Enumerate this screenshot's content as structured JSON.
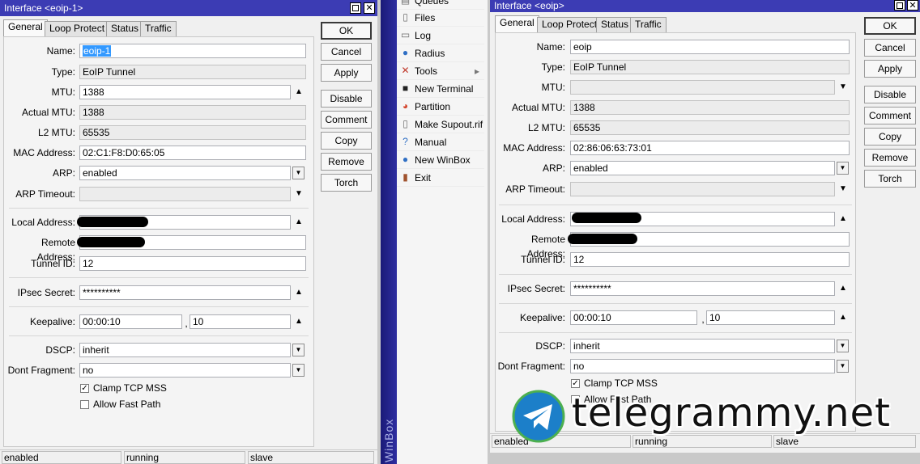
{
  "left_window": {
    "title": "Interface <eoip-1>",
    "tabs": [
      "General",
      "Loop Protect",
      "Status",
      "Traffic"
    ],
    "fields": {
      "name_label": "Name:",
      "name": "eoip-1",
      "type_label": "Type:",
      "type": "EoIP Tunnel",
      "mtu_label": "MTU:",
      "mtu": "1388",
      "actual_mtu_label": "Actual MTU:",
      "actual_mtu": "1388",
      "l2mtu_label": "L2 MTU:",
      "l2mtu": "65535",
      "mac_label": "MAC Address:",
      "mac": "02:C1:F8:D0:65:05",
      "arp_label": "ARP:",
      "arp": "enabled",
      "arp_timeout_label": "ARP Timeout:",
      "arp_timeout": "",
      "local_address_label": "Local Address:",
      "remote_address_label": "Remote Address:",
      "tunnel_id_label": "Tunnel ID:",
      "tunnel_id": "12",
      "ipsec_label": "IPsec Secret:",
      "ipsec": "**********",
      "keepalive_label": "Keepalive:",
      "keepalive": "00:00:10",
      "keepalive_retries": "10",
      "comma": ",",
      "dscp_label": "DSCP:",
      "dscp": "inherit",
      "dont_fragment_label": "Dont Fragment:",
      "dont_fragment": "no",
      "clamp_label": "Clamp TCP MSS",
      "fastpath_label": "Allow Fast Path"
    },
    "buttons": [
      "OK",
      "Cancel",
      "Apply",
      "Disable",
      "Comment",
      "Copy",
      "Remove",
      "Torch"
    ],
    "status": [
      "enabled",
      "running",
      "slave"
    ]
  },
  "menu": {
    "items": [
      {
        "label": "Queues",
        "icon": "queues-icon",
        "glyph": "▤",
        "color": "#6b6b6b"
      },
      {
        "label": "Files",
        "icon": "files-icon",
        "glyph": "▯",
        "color": "#6b6b6b"
      },
      {
        "label": "Log",
        "icon": "log-icon",
        "glyph": "▭",
        "color": "#6b6b6b"
      },
      {
        "label": "Radius",
        "icon": "radius-icon",
        "glyph": "●",
        "color": "#2f6fc4"
      },
      {
        "label": "Tools",
        "icon": "tools-icon",
        "glyph": "✕",
        "color": "#c0392b"
      },
      {
        "label": "New Terminal",
        "icon": "terminal-icon",
        "glyph": "■",
        "color": "#222222"
      },
      {
        "label": "Partition",
        "icon": "partition-icon",
        "glyph": "◕",
        "color": "#d3432b"
      },
      {
        "label": "Make Supout.rif",
        "icon": "supout-icon",
        "glyph": "▯",
        "color": "#6b6b6b"
      },
      {
        "label": "Manual",
        "icon": "manual-icon",
        "glyph": "?",
        "color": "#2f6fc4"
      },
      {
        "label": "New WinBox",
        "icon": "winbox-icon",
        "glyph": "●",
        "color": "#2f6fc4"
      },
      {
        "label": "Exit",
        "icon": "exit-icon",
        "glyph": "▮",
        "color": "#a0522d"
      }
    ],
    "tools_arrow": "▸",
    "sidebar_text": "WinBox"
  },
  "right_window": {
    "title": "Interface <eoip>",
    "tabs": [
      "General",
      "Loop Protect",
      "Status",
      "Traffic"
    ],
    "fields": {
      "name_label": "Name:",
      "name": "eoip",
      "type_label": "Type:",
      "type": "EoIP Tunnel",
      "mtu_label": "MTU:",
      "mtu": "",
      "actual_mtu_label": "Actual MTU:",
      "actual_mtu": "1388",
      "l2mtu_label": "L2 MTU:",
      "l2mtu": "65535",
      "mac_label": "MAC Address:",
      "mac": "02:86:06:63:73:01",
      "arp_label": "ARP:",
      "arp": "enabled",
      "arp_timeout_label": "ARP Timeout:",
      "arp_timeout": "",
      "local_address_label": "Local Address:",
      "remote_address_label": "Remote Address:",
      "tunnel_id_label": "Tunnel ID:",
      "tunnel_id": "12",
      "ipsec_label": "IPsec Secret:",
      "ipsec": "**********",
      "keepalive_label": "Keepalive:",
      "keepalive": "00:00:10",
      "keepalive_retries": "10",
      "comma": ",",
      "dscp_label": "DSCP:",
      "dscp": "inherit",
      "dont_fragment_label": "Dont Fragment:",
      "dont_fragment": "no",
      "clamp_label": "Clamp TCP MSS",
      "fastpath_label": "Allow Fast Path"
    },
    "buttons": [
      "OK",
      "Cancel",
      "Apply",
      "Disable",
      "Comment",
      "Copy",
      "Remove",
      "Torch"
    ],
    "status": [
      "enabled",
      "running",
      "slave"
    ]
  },
  "watermark": {
    "text": "telegrammy.net"
  }
}
